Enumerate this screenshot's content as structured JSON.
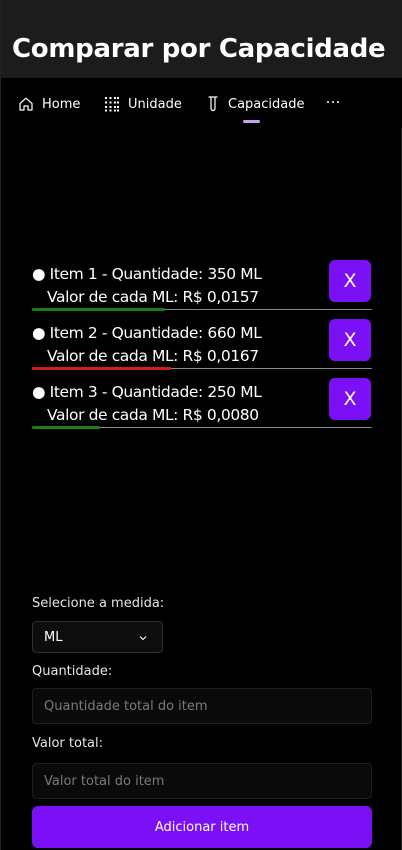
{
  "window": {
    "title": "Comparar por Capacidade"
  },
  "nav": {
    "items": [
      {
        "label": "Home",
        "icon": "home-icon"
      },
      {
        "label": "Unidade",
        "icon": "grid-icon"
      },
      {
        "label": "Capacidade",
        "icon": "test-tube-icon",
        "selected": true
      }
    ],
    "more_icon": "more-icon",
    "indicator_color": "#c8a2f0"
  },
  "items": [
    {
      "line1": "● Item 1 - Quantidade: 350 ML",
      "line2": "Valor de cada ML: R$ 0,0157",
      "remove_label": "X",
      "bar_color": "#1a7f1a",
      "bar_fraction": 0.39
    },
    {
      "line1": "● Item 2 - Quantidade: 660 ML",
      "line2": "Valor de cada ML: R$ 0,0167",
      "remove_label": "X",
      "bar_color": "#d11a1a",
      "bar_fraction": 0.41
    },
    {
      "line1": "● Item 3 - Quantidade: 250 ML",
      "line2": "Valor de cada ML: R$ 0,0080",
      "remove_label": "X",
      "bar_color": "#1a7f1a",
      "bar_fraction": 0.2
    }
  ],
  "form": {
    "measure_label": "Selecione a medida:",
    "measure_value": "ML",
    "quantity_label": "Quantidade:",
    "quantity_placeholder": "Quantidade total do item",
    "total_label": "Valor total:",
    "total_placeholder": "Valor total do item",
    "add_button": "Adicionar item"
  },
  "colors": {
    "accent": "#7b0ff5",
    "background": "#000000",
    "titlebar": "#1c1c1c"
  }
}
